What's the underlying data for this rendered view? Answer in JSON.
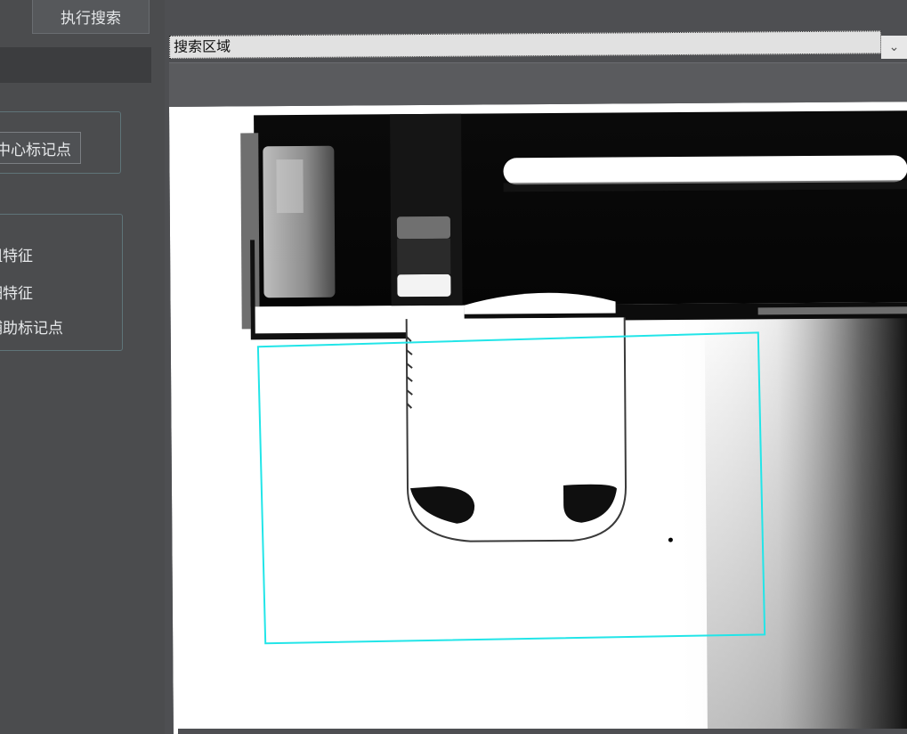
{
  "toolbar": {
    "execute_search_label": "执行搜索"
  },
  "search_region_select": {
    "selected": "搜索区域"
  },
  "markers": {
    "center_marker_button": "中心标记点"
  },
  "features": {
    "options": [
      "粗特征",
      "细特征",
      "辅助标记点"
    ]
  },
  "colors": {
    "roi_rectangle": "#22e5e8",
    "panel_bg": "#4a4b4d",
    "button_bg": "#56585b"
  },
  "icons": {
    "dropdown": "chevron-down-icon"
  }
}
